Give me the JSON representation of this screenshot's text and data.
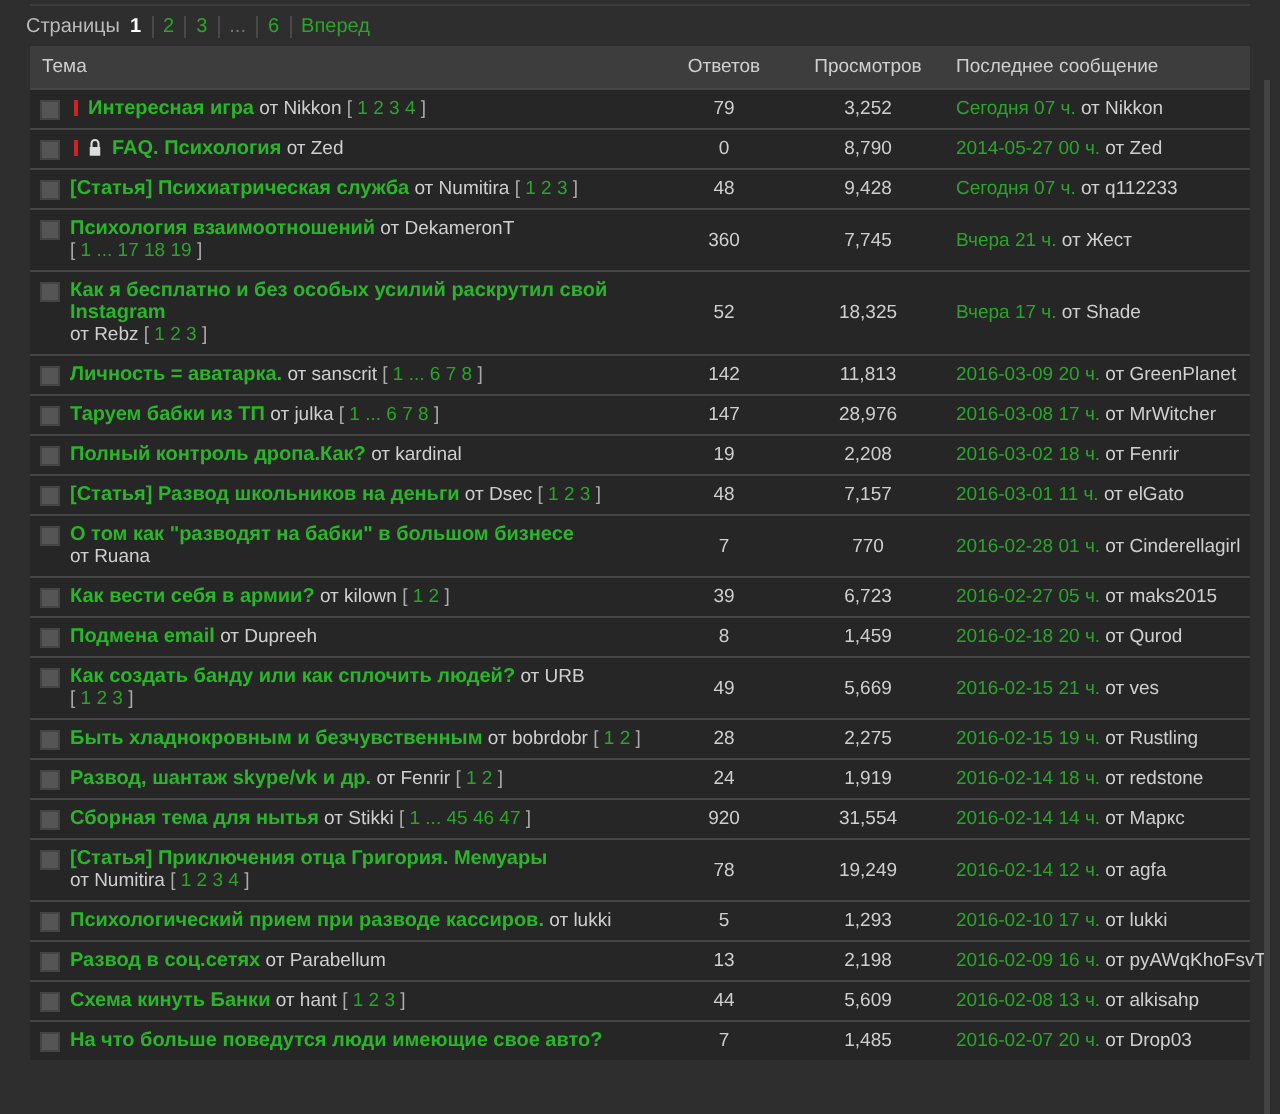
{
  "pagination": {
    "label": "Страницы",
    "items": [
      {
        "label": "1",
        "kind": "page",
        "selected": true
      },
      {
        "label": "2",
        "kind": "page",
        "selected": false
      },
      {
        "label": "3",
        "kind": "page",
        "selected": false
      },
      {
        "label": "...",
        "kind": "gap"
      },
      {
        "label": "6",
        "kind": "page",
        "selected": false
      },
      {
        "label": "Вперед",
        "kind": "next"
      }
    ]
  },
  "table": {
    "columns": [
      "Тема",
      "Ответов",
      "Просмотров",
      "Последнее сообщение"
    ],
    "rows": [
      {
        "checked": false,
        "pinned": true,
        "locked": false,
        "title": "Интересная игра",
        "author": "от Nikkon",
        "pages": {
          "open": "[",
          "links": [
            "1",
            "2",
            "3",
            "4"
          ],
          "close": "]"
        },
        "replies": "79",
        "views": "3,252",
        "last_time": "Сегодня 07 ч.",
        "last_author": "от Nikkon"
      },
      {
        "checked": false,
        "pinned": true,
        "locked": true,
        "title": "FAQ. Психология",
        "author": "от Zed",
        "replies": "0",
        "views": "8,790",
        "last_time": "2014-05-27 00 ч.",
        "last_author": "от Zed"
      },
      {
        "checked": false,
        "pinned": false,
        "locked": false,
        "title": "[Статья] Психиатрическая служба",
        "author": "от Numitira",
        "pages": {
          "open": "[",
          "links": [
            "1",
            "2",
            "3"
          ],
          "close": "]"
        },
        "replies": "48",
        "views": "9,428",
        "last_time": "Сегодня 07 ч.",
        "last_author": "от q112233"
      },
      {
        "checked": false,
        "pinned": false,
        "locked": false,
        "title": "Психология взаимоотношений",
        "author": "от DekameronT",
        "pages": {
          "open": "[",
          "links": [
            "1",
            "...",
            "17",
            "18",
            "19"
          ],
          "close": "]"
        },
        "replies": "360",
        "views": "7,745",
        "last_time": "Вчера 21 ч.",
        "last_author": "от Жест"
      },
      {
        "checked": false,
        "pinned": false,
        "locked": false,
        "title": "Как я бесплатно и без особых усилий раскрутил свой Instagram",
        "author": "от Rebz",
        "pages": {
          "open": "[",
          "links": [
            "1",
            "2",
            "3"
          ],
          "close": "]"
        },
        "replies": "52",
        "views": "18,325",
        "last_time": "Вчера 17 ч.",
        "last_author": "от Shade"
      },
      {
        "checked": false,
        "pinned": false,
        "locked": false,
        "title": "Личность = аватарка.",
        "author": "от sanscrit",
        "pages": {
          "open": "[",
          "links": [
            "1",
            "...",
            "6",
            "7",
            "8"
          ],
          "close": "]"
        },
        "replies": "142",
        "views": "11,813",
        "last_time": "2016-03-09 20 ч.",
        "last_author": "от GreenPlanet"
      },
      {
        "checked": false,
        "pinned": false,
        "locked": false,
        "title": "Таруем бабки из ТП",
        "author": "от julka",
        "pages": {
          "open": "[",
          "links": [
            "1",
            "...",
            "6",
            "7",
            "8"
          ],
          "close": "]"
        },
        "replies": "147",
        "views": "28,976",
        "last_time": "2016-03-08 17 ч.",
        "last_author": "от MrWitcher"
      },
      {
        "checked": false,
        "pinned": false,
        "locked": false,
        "title": "Полный контроль дропа.Как?",
        "author": "от kardinal",
        "replies": "19",
        "views": "2,208",
        "last_time": "2016-03-02 18 ч.",
        "last_author": "от Fenrir"
      },
      {
        "checked": false,
        "pinned": false,
        "locked": false,
        "title": "[Статья] Развод школьников на деньги",
        "author": "от Dsec",
        "pages": {
          "open": "[",
          "links": [
            "1",
            "2",
            "3"
          ],
          "close": "]"
        },
        "replies": "48",
        "views": "7,157",
        "last_time": "2016-03-01 11 ч.",
        "last_author": "от elGato"
      },
      {
        "checked": false,
        "pinned": false,
        "locked": false,
        "title": "О том как \"разводят на бабки\" в большом бизнесе",
        "author": "от Ruana",
        "replies": "7",
        "views": "770",
        "last_time": "2016-02-28 01 ч.",
        "last_author": "от Cinderellagirl"
      },
      {
        "checked": false,
        "pinned": false,
        "locked": false,
        "title": "Как вести себя в армии?",
        "author": "от kilown",
        "pages": {
          "open": "[",
          "links": [
            "1",
            "2"
          ],
          "close": "]"
        },
        "replies": "39",
        "views": "6,723",
        "last_time": "2016-02-27 05 ч.",
        "last_author": "от maks2015"
      },
      {
        "checked": false,
        "pinned": false,
        "locked": false,
        "title": "Подмена email",
        "author": "от Dupreeh",
        "replies": "8",
        "views": "1,459",
        "last_time": "2016-02-18 20 ч.",
        "last_author": "от Qurod"
      },
      {
        "checked": false,
        "pinned": false,
        "locked": false,
        "title": "Как создать банду или как сплочить людей?",
        "author": "от URB",
        "pages": {
          "open": "[",
          "links": [
            "1",
            "2",
            "3"
          ],
          "close": "]"
        },
        "replies": "49",
        "views": "5,669",
        "last_time": "2016-02-15 21 ч.",
        "last_author": "от ves"
      },
      {
        "checked": false,
        "pinned": false,
        "locked": false,
        "title": "Быть хладнокровным и безчувственным",
        "author": "от bobrdobr",
        "pages": {
          "open": "[",
          "links": [
            "1",
            "2"
          ],
          "close": "]"
        },
        "replies": "28",
        "views": "2,275",
        "last_time": "2016-02-15 19 ч.",
        "last_author": "от Rustling"
      },
      {
        "checked": false,
        "pinned": false,
        "locked": false,
        "title": "Развод, шантаж skype/vk и др.",
        "author": "от Fenrir",
        "pages": {
          "open": "[",
          "links": [
            "1",
            "2"
          ],
          "close": "]"
        },
        "replies": "24",
        "views": "1,919",
        "last_time": "2016-02-14 18 ч.",
        "last_author": "от redstone"
      },
      {
        "checked": false,
        "pinned": false,
        "locked": false,
        "title": "Сборная тема для нытья",
        "author": "от Stikki",
        "pages": {
          "open": "[",
          "links": [
            "1",
            "...",
            "45",
            "46",
            "47"
          ],
          "close": "]"
        },
        "replies": "920",
        "views": "31,554",
        "last_time": "2016-02-14 14 ч.",
        "last_author": "от Маркс"
      },
      {
        "checked": false,
        "pinned": false,
        "locked": false,
        "title": "[Статья] Приключения отца Григория. Мемуары",
        "author": "от Numitira",
        "pages": {
          "open": "[",
          "links": [
            "1",
            "2",
            "3",
            "4"
          ],
          "close": "]"
        },
        "replies": "78",
        "views": "19,249",
        "last_time": "2016-02-14 12 ч.",
        "last_author": "от agfa"
      },
      {
        "checked": false,
        "pinned": false,
        "locked": false,
        "title": "Психологический прием при разводе кассиров.",
        "author": "от lukki",
        "replies": "5",
        "views": "1,293",
        "last_time": "2016-02-10 17 ч.",
        "last_author": "от lukki"
      },
      {
        "checked": false,
        "pinned": false,
        "locked": false,
        "title": "Развод в соц.сетях",
        "author": "от Parabellum",
        "replies": "13",
        "views": "2,198",
        "last_time": "2016-02-09 16 ч.",
        "last_author": "от pyAWqKhoFsvT"
      },
      {
        "checked": false,
        "pinned": false,
        "locked": false,
        "title": "Схема кинуть Банки",
        "author": "от hant",
        "pages": {
          "open": "[",
          "links": [
            "1",
            "2",
            "3"
          ],
          "close": "]"
        },
        "replies": "44",
        "views": "5,609",
        "last_time": "2016-02-08 13 ч.",
        "last_author": "от alkisahp"
      },
      {
        "checked": false,
        "pinned": false,
        "locked": false,
        "title": "На что больше поведутся люди имеющие свое авто?",
        "replies": "7",
        "views": "1,485",
        "last_time": "2016-02-07 20 ч.",
        "last_author": "от Drop03"
      }
    ]
  }
}
